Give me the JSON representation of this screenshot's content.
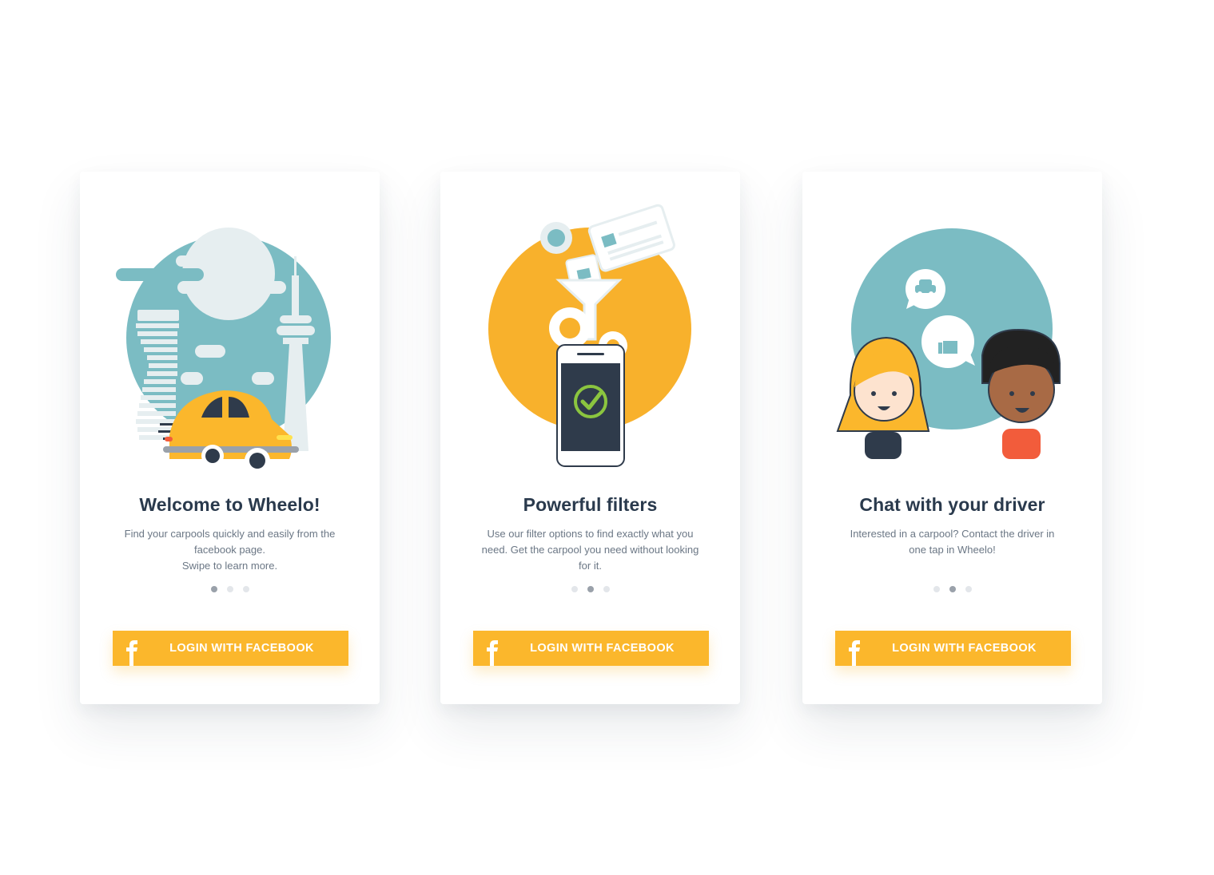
{
  "cards": [
    {
      "title": "Welcome to Wheelo!",
      "description": [
        "Find your carpools quickly and easily from the",
        "facebook page.",
        "Swipe to learn more."
      ],
      "active_dot": 1,
      "button_label": "LOGIN WITH FACEBOOK",
      "illustration": "city-car-illustration"
    },
    {
      "title": "Powerful filters",
      "description": [
        "Use our filter options to find exactly what you",
        "need. Get the carpool you need without looking",
        "for it."
      ],
      "active_dot": 2,
      "button_label": "LOGIN WITH FACEBOOK",
      "illustration": "filter-phone-illustration"
    },
    {
      "title": "Chat with your driver",
      "description": [
        "Interested in a carpool? Contact the driver in",
        "one tap in Wheelo!"
      ],
      "active_dot": 2,
      "button_label": "LOGIN WITH FACEBOOK",
      "illustration": "chat-people-illustration"
    }
  ],
  "colors": {
    "accent": "#fbb72c",
    "teal": "#7bbcc3",
    "title": "#2a3a4d",
    "text": "#6b7785",
    "dot_active": "#9aa1aa",
    "dot_inactive": "#e3e6ea"
  }
}
